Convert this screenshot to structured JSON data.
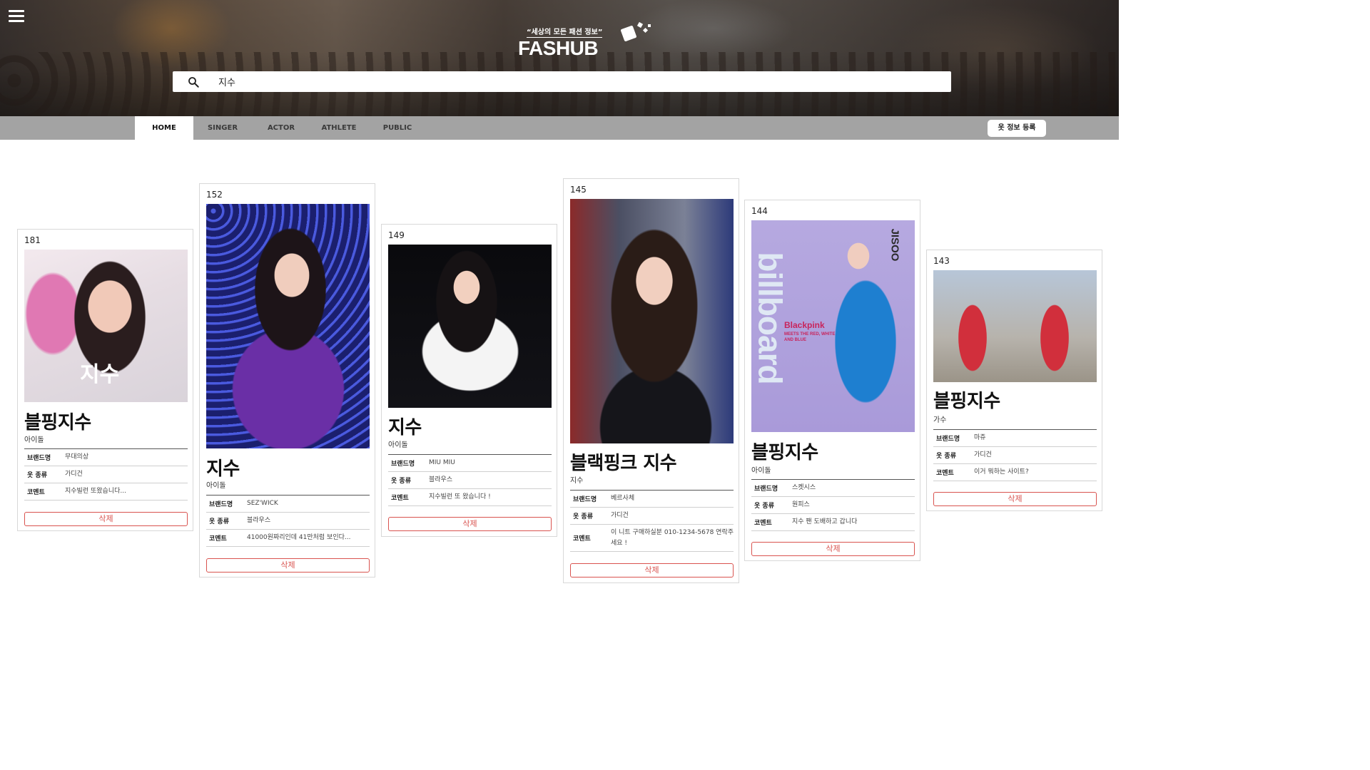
{
  "app": {
    "logo_tagline": "“세상의 모든 패션 정보”",
    "logo_name": "FASHUB"
  },
  "search": {
    "value": "지수",
    "placeholder": ""
  },
  "nav": {
    "tabs": [
      {
        "label": "HOME",
        "active": true
      },
      {
        "label": "SINGER",
        "active": false
      },
      {
        "label": "ACTOR",
        "active": false
      },
      {
        "label": "ATHLETE",
        "active": false
      },
      {
        "label": "PUBLIC",
        "active": false
      }
    ],
    "register_label": "옷 정보 등록"
  },
  "field_labels": {
    "brand": "브랜드명",
    "type": "옷 종류",
    "comment": "코멘트"
  },
  "delete_label": "삭제",
  "cards": [
    {
      "id": "181",
      "name": "블핑지수",
      "category": "아이돌",
      "brand": "무대의상",
      "type": "가디건",
      "comment": "지수빌런 또왔습니다...",
      "overlay": "지수"
    },
    {
      "id": "152",
      "name": "지수",
      "category": "아이돌",
      "brand": "SEZ'WICK",
      "type": "블라우스",
      "comment": "41000원짜리인데 41만처럼 보인다..."
    },
    {
      "id": "149",
      "name": "지수",
      "category": "아이돌",
      "brand": "MIU MIU",
      "type": "블라우스",
      "comment": "지수빌런 또 왔습니다 !"
    },
    {
      "id": "145",
      "name": "블랙핑크 지수",
      "category": "지수",
      "brand": "베르사체",
      "type": "가디건",
      "comment": "이 니트 구매하실분 010-1234-5678 연락주세요 !"
    },
    {
      "id": "144",
      "name": "블핑지수",
      "category": "아이돌",
      "brand": "스켓시스",
      "type": "원피스",
      "comment": "지수 팬 도배하고 갑니다",
      "magazine": "billboard",
      "magazine_sub": "JISOO",
      "magazine_blurb": "Blackpink",
      "magazine_blurb2": "MEETS THE RED, WHITE AND BLUE"
    },
    {
      "id": "143",
      "name": "블핑지수",
      "category": "가수",
      "brand": "마쥬",
      "type": "가디건",
      "comment": "이거 뭐하는 사이트?"
    }
  ]
}
